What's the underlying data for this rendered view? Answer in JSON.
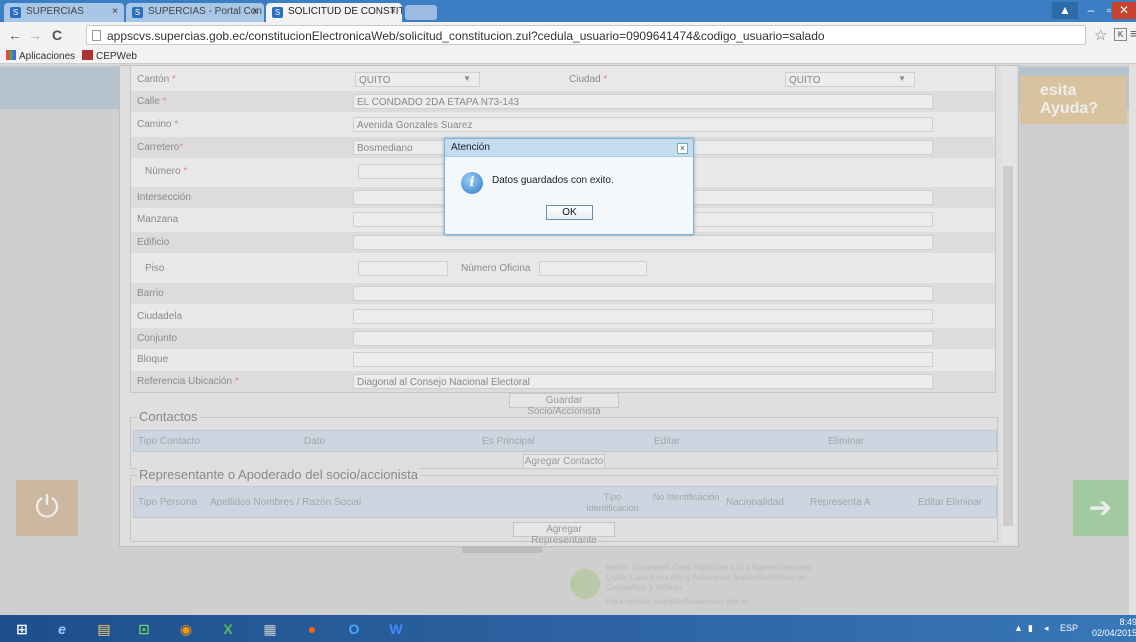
{
  "browser": {
    "tabs": [
      {
        "label": "SUPERCIAS"
      },
      {
        "label": "SUPERCIAS - Portal Con"
      },
      {
        "label": "SOLICITUD DE CONSTITU"
      }
    ],
    "url": "appscvs.supercias.gob.ec/constitucionElectronicaWeb/solicitud_constitucion.zul?cedula_usuario=0909641474&codigo_usuario=salado",
    "bookmarks": [
      "Aplicaciones",
      "CEPWeb"
    ]
  },
  "form": {
    "canton": {
      "label": "Cantón",
      "value": "QUITO"
    },
    "ciudad": {
      "label": "Ciudad",
      "value": "QUITO"
    },
    "calle": {
      "label": "Calle",
      "value": "EL CONDADO 2DA ETAPA N73-143"
    },
    "camino": {
      "label": "Camino",
      "value": "Avenida Gonzales Suarez"
    },
    "carretero": {
      "label": "Carretero",
      "value": "Bosmediano"
    },
    "numero": {
      "label": "Número"
    },
    "interseccion": {
      "label": "Intersección"
    },
    "manzana": {
      "label": "Manzana"
    },
    "edificio": {
      "label": "Edificio"
    },
    "piso": {
      "label": "Piso"
    },
    "numero_oficina": {
      "label": "Número Oficina"
    },
    "barrio": {
      "label": "Barrio"
    },
    "ciudadela": {
      "label": "Ciudadela"
    },
    "conjunto": {
      "label": "Conjunto"
    },
    "bloque": {
      "label": "Bloque"
    },
    "referencia": {
      "label": "Referencia Ubicación",
      "value": "Diagonal al Consejo Nacional Electoral"
    },
    "req_mark": "*",
    "save_button": "Guardar Socio/Accionista"
  },
  "contactos": {
    "title": "Contactos",
    "columns": [
      "Tipo Contacto",
      "Dato",
      "Es Principal",
      "Editar",
      "Eliminar"
    ],
    "add_button": "Agregar Contacto"
  },
  "representante": {
    "title": "Representante o Apoderado del socio/accionista",
    "columns": [
      "Tipo Persona",
      "Apellidos Nombres / Razón Social",
      "Tipo Identificación",
      "No Identificación",
      "Nacionalidad",
      "Representa A",
      "Editar",
      "Eliminar"
    ],
    "add_button": "Agregar Representante"
  },
  "help": {
    "title": "esita Ayuda?"
  },
  "dialog": {
    "title": "Atención",
    "close": "×",
    "message": "Datos guardados con exito.",
    "ok": "OK",
    "icon_letter": "i"
  },
  "footer": {
    "line1": "Matriz: Guayaquil: Calle Pichincha 410 y Aguirre (esquina)",
    "line2": "Quito: Calle Roca 660 y Amazonas Superintendencia de",
    "line3": "Compañías y Valores",
    "line4": "Para reporte: soporte@supercias.gob.ec"
  },
  "taskbar": {
    "lang": "ESP",
    "time": "8:49",
    "date": "02/04/2015"
  },
  "colors": {
    "accent": "#3c7ec4",
    "dialog_border": "#7fb2d6"
  }
}
